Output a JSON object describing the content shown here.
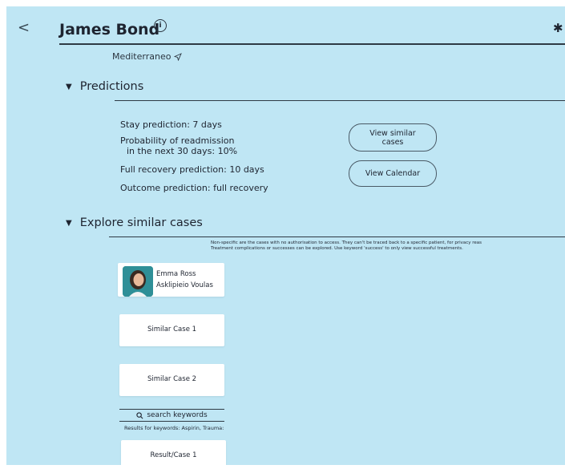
{
  "header": {
    "back_glyph": "<",
    "title": "James Bond",
    "info_glyph": "i",
    "settings_glyph": "✱",
    "location": "Mediterraneo",
    "location_icon": "send-icon"
  },
  "predictions": {
    "heading": "Predictions",
    "stay": "Stay prediction:  7 days",
    "readmission_line1": "Probability of readmission",
    "readmission_line2": "in the next 30 days: 10%",
    "recovery": "Full recovery prediction: 10 days",
    "outcome": "Outcome prediction: full recovery",
    "view_similar_line1": "View similar",
    "view_similar_line2": "cases",
    "view_calendar": "View Calendar"
  },
  "explore": {
    "heading": "Explore similar cases",
    "note_line1": "Non-specific are the cases with no authorisation to access. They can't be traced back to a specific patient, for privacy reas",
    "note_line2": "Treatment complications or successes can be explored. Use keyword 'success' to only view successful treatments.",
    "person": {
      "name": "Emma Ross",
      "hospital": "Asklipieio Voulas"
    },
    "cases": [
      "Similar Case 1",
      "Similar Case 2"
    ],
    "search_placeholder": "search keywords",
    "results_text": "Results for keywords: Aspirin, Trauma:",
    "result_case": "Result/Case 1"
  },
  "colors": {
    "background": "#bfe6f4",
    "card": "#ffffff",
    "text": "#1e2430"
  }
}
